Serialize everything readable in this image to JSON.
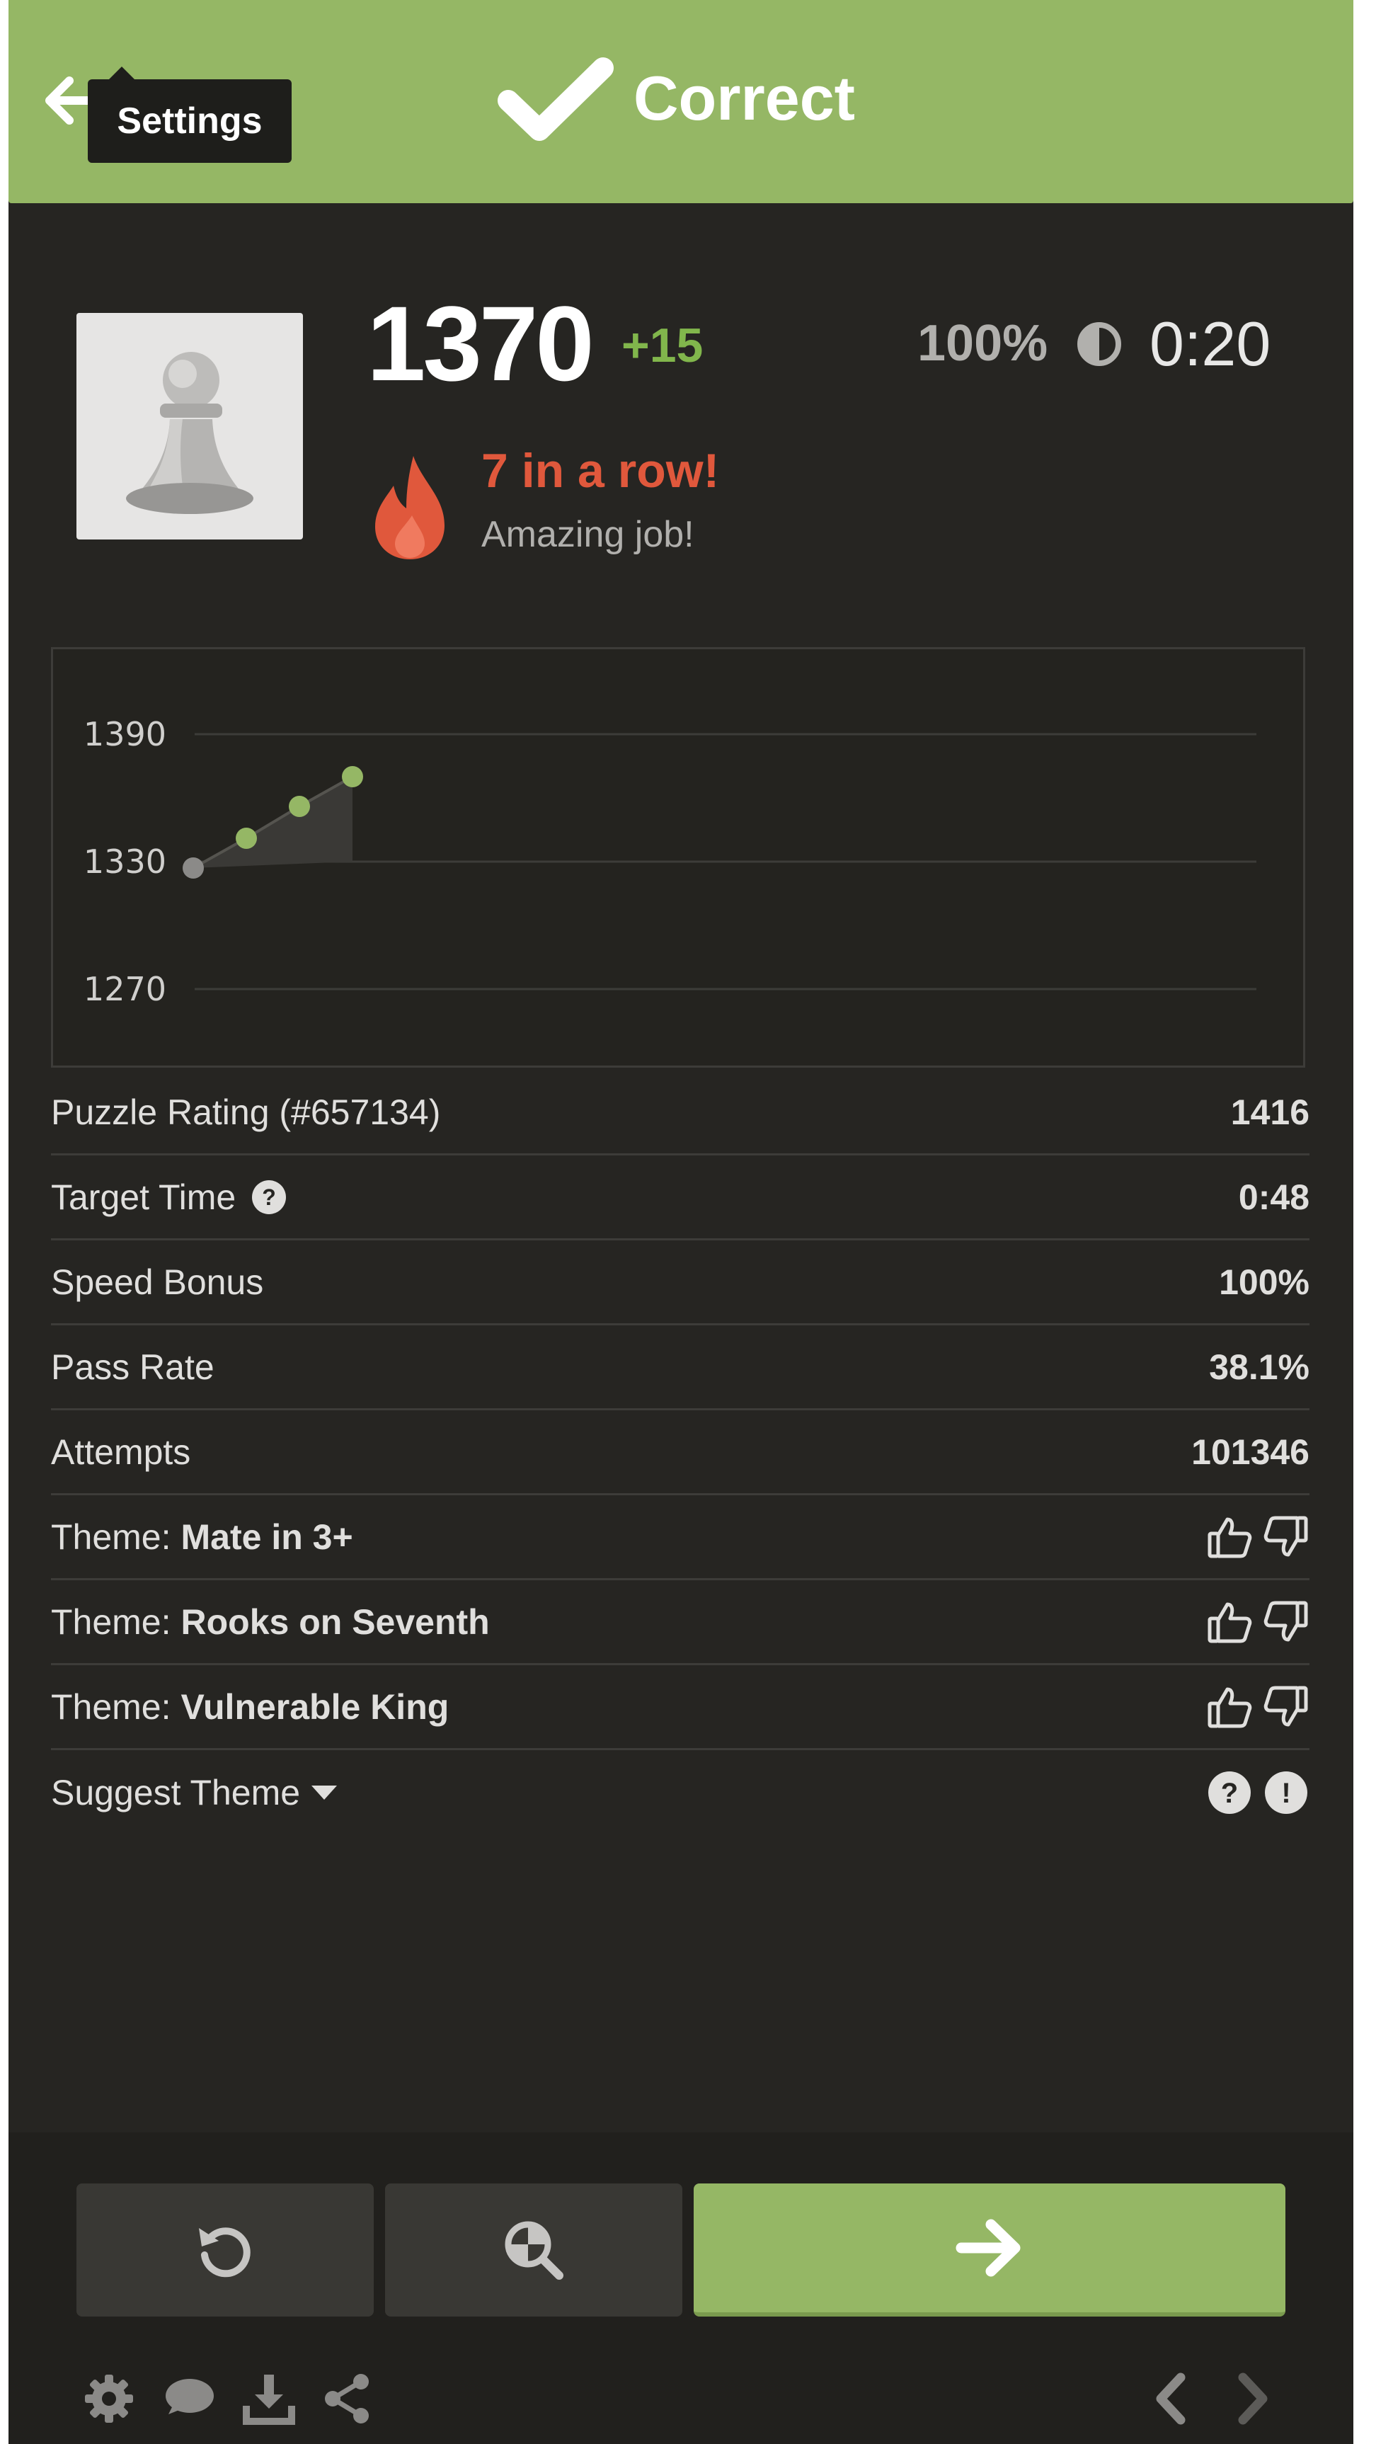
{
  "header": {
    "status_label": "Correct",
    "tooltip": "Settings",
    "accent_color": "#95b765"
  },
  "result": {
    "rating": "1370",
    "rating_change": "+15",
    "accuracy": "100%",
    "time": "0:20",
    "streak_title": "7 in a row!",
    "streak_subtitle": "Amazing job!"
  },
  "chart_data": {
    "type": "line",
    "x": [
      1,
      2,
      3,
      4
    ],
    "values": [
      1327,
      1341,
      1356,
      1370
    ],
    "ylim": [
      1270,
      1390
    ],
    "yticks": [
      "1390",
      "1330",
      "1270"
    ],
    "grid": true
  },
  "stats": {
    "puzzle_rating_label": "Puzzle Rating (#657134)",
    "puzzle_rating_value": "1416",
    "target_time_label": "Target Time",
    "target_time_value": "0:48",
    "speed_bonus_label": "Speed Bonus",
    "speed_bonus_value": "100%",
    "pass_rate_label": "Pass Rate",
    "pass_rate_value": "38.1%",
    "attempts_label": "Attempts",
    "attempts_value": "101346"
  },
  "themes": {
    "prefix": "Theme:",
    "items": [
      "Mate in 3+",
      "Rooks on Seventh",
      "Vulnerable King"
    ],
    "suggest_label": "Suggest Theme"
  },
  "icons": {
    "header": [
      "back-arrow-icon",
      "checkmark-icon"
    ],
    "footer_buttons": [
      "retry-icon",
      "analysis-icon",
      "next-arrow-icon"
    ],
    "toolbar": [
      "gear-icon",
      "chat-icon",
      "download-icon",
      "share-icon",
      "chevron-left-icon",
      "chevron-right-icon"
    ]
  }
}
